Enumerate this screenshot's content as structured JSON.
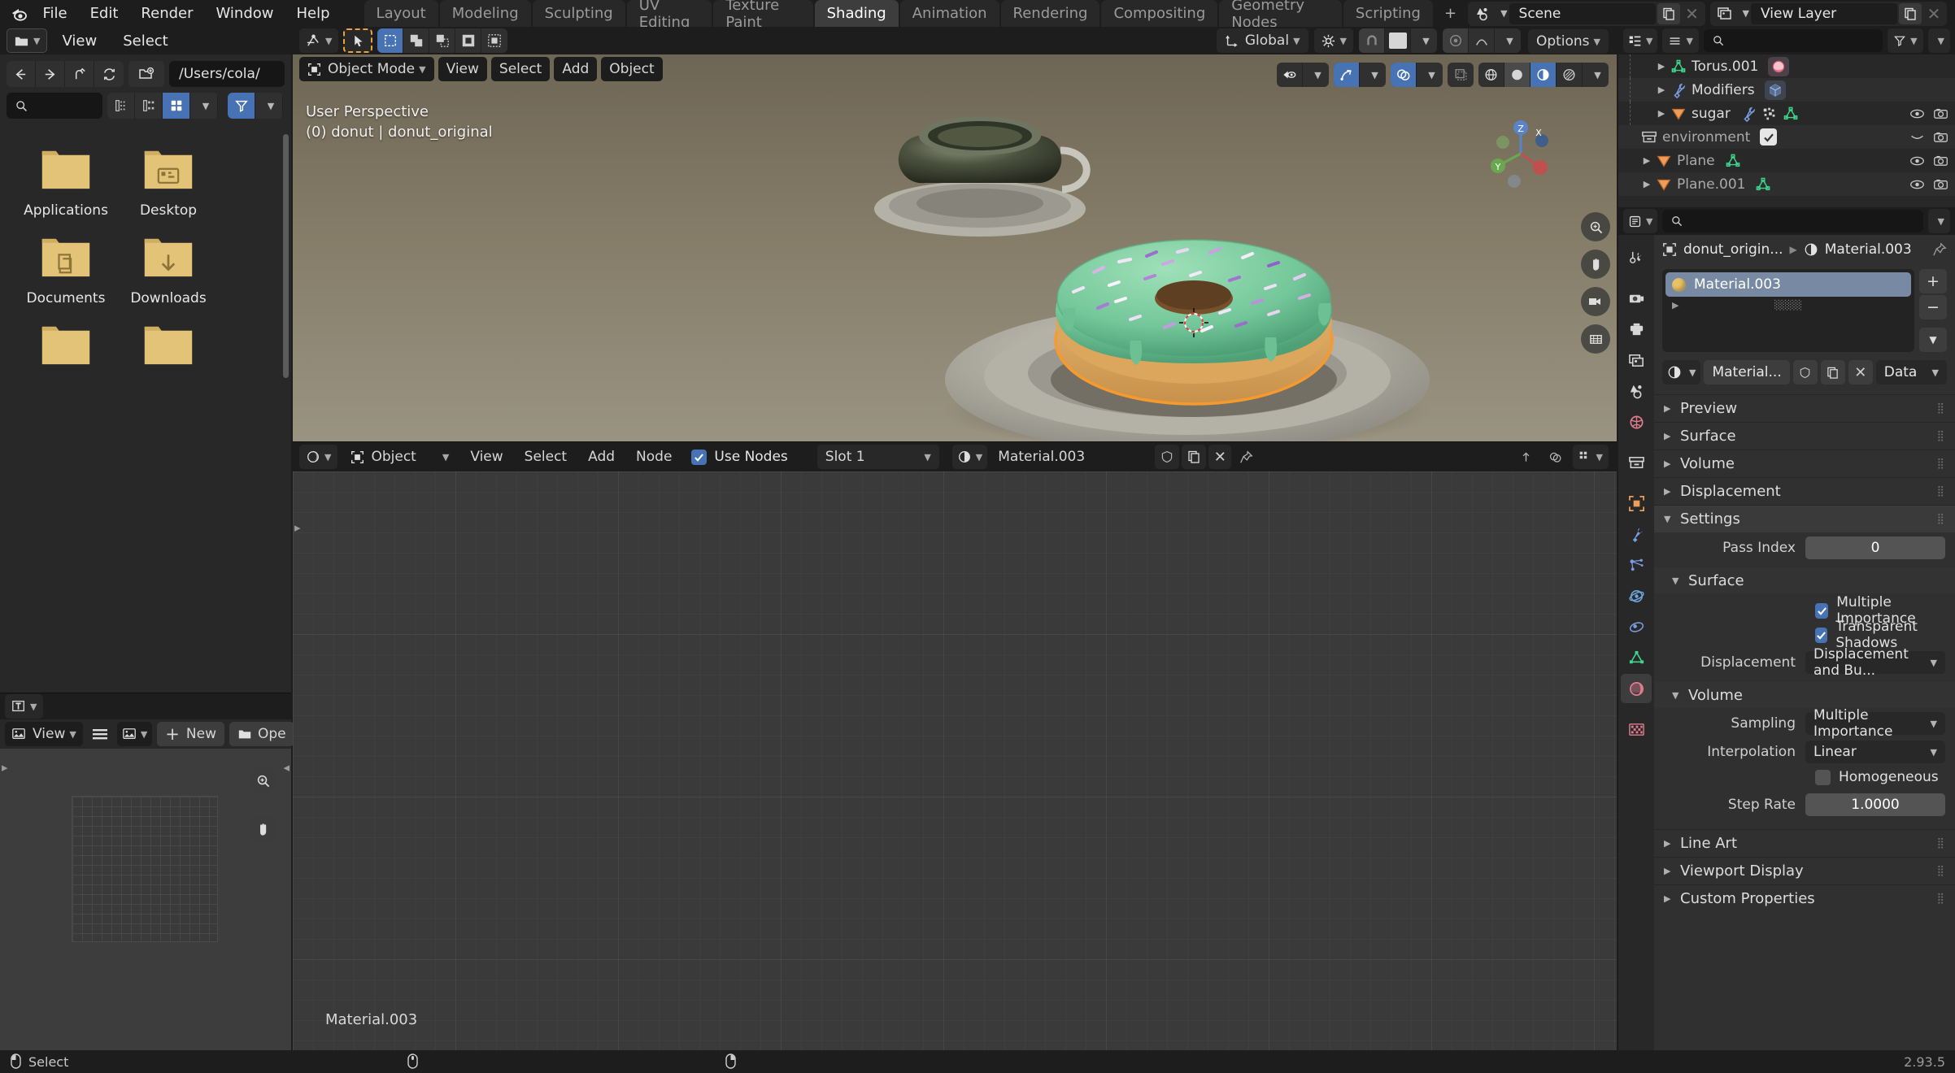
{
  "app": {
    "version": "2.93.5"
  },
  "topbar": {
    "menus": [
      "File",
      "Edit",
      "Render",
      "Window",
      "Help"
    ],
    "workspaces": [
      {
        "label": "Layout",
        "active": false
      },
      {
        "label": "Modeling",
        "active": false
      },
      {
        "label": "Sculpting",
        "active": false
      },
      {
        "label": "UV Editing",
        "active": false
      },
      {
        "label": "Texture Paint",
        "active": false
      },
      {
        "label": "Shading",
        "active": true
      },
      {
        "label": "Animation",
        "active": false
      },
      {
        "label": "Rendering",
        "active": false
      },
      {
        "label": "Compositing",
        "active": false
      },
      {
        "label": "Geometry Nodes",
        "active": false
      },
      {
        "label": "Scripting",
        "active": false
      }
    ],
    "add_workspace": "+",
    "scene": {
      "label": "Scene"
    },
    "view_layer": {
      "label": "View Layer"
    }
  },
  "file_browser": {
    "menus": [
      "View",
      "Select"
    ],
    "path": "/Users/cola/",
    "search_placeholder": "",
    "items": [
      {
        "label": "Applications",
        "icon": "folder-plain-icon"
      },
      {
        "label": "Desktop",
        "icon": "folder-desktop-icon"
      },
      {
        "label": "Documents",
        "icon": "folder-documents-icon"
      },
      {
        "label": "Downloads",
        "icon": "folder-downloads-icon"
      },
      {
        "label": "",
        "icon": "folder-plain-icon"
      },
      {
        "label": "",
        "icon": "folder-plain-icon"
      }
    ]
  },
  "image_editor": {
    "view_menu": "View",
    "new_button": "New",
    "open_button": "Ope"
  },
  "viewport": {
    "mode": "Object Mode",
    "menus": [
      "View",
      "Select",
      "Add",
      "Object"
    ],
    "transform_orientation": "Global",
    "options_label": "Options",
    "overlay_line1": "User Perspective",
    "overlay_line2": "(0) donut | donut_original",
    "gizmo_axes": [
      "X",
      "Y",
      "Z"
    ]
  },
  "shader_editor": {
    "mode": "Object",
    "menus": [
      "View",
      "Select",
      "Add",
      "Node"
    ],
    "use_nodes_label": "Use Nodes",
    "use_nodes_checked": true,
    "slot": "Slot 1",
    "material_name": "Material.003",
    "canvas_label": "Material.003"
  },
  "outliner": {
    "search_placeholder": "",
    "rows": [
      {
        "label": "Torus.001",
        "icon": "mesh-data-icon",
        "indent": 2,
        "expand": "collapsed",
        "badge": "material-icon",
        "eye": false,
        "camera": false
      },
      {
        "label": "Modifiers",
        "icon": "wrench-icon",
        "indent": 2,
        "expand": "collapsed",
        "badge": "modifier-cube-icon",
        "eye": false,
        "camera": false
      },
      {
        "label": "sugar",
        "icon": "object-mesh-icon",
        "indent": 2,
        "expand": "collapsed",
        "badge": "wrench-particles-mesh",
        "eye": true,
        "camera": true
      },
      {
        "label": "environment",
        "icon": "collection-icon",
        "indent": 0,
        "expand": "none",
        "badge": "checkbox-on",
        "eye": false,
        "camera": true
      },
      {
        "label": "Plane",
        "icon": "object-mesh-icon",
        "indent": 1,
        "expand": "collapsed",
        "badge": "mesh-data-icon",
        "eye": true,
        "camera": true
      },
      {
        "label": "Plane.001",
        "icon": "object-mesh-icon",
        "indent": 1,
        "expand": "collapsed",
        "badge": "mesh-data-icon",
        "eye": true,
        "camera": true
      }
    ]
  },
  "properties": {
    "search_placeholder": "",
    "breadcrumb": [
      "donut_origin...",
      "Material.003"
    ],
    "material_slots": [
      {
        "name": "Material.003",
        "selected": true
      }
    ],
    "material_id": {
      "name": "Material...",
      "data_label": "Data"
    },
    "panels": [
      {
        "label": "Preview",
        "open": false
      },
      {
        "label": "Surface",
        "open": false
      },
      {
        "label": "Volume",
        "open": false
      },
      {
        "label": "Displacement",
        "open": false
      },
      {
        "label": "Settings",
        "open": true
      }
    ],
    "settings": {
      "pass_index_label": "Pass Index",
      "pass_index_value": "0",
      "surface_subpanel": "Surface",
      "multiple_importance_label": "Multiple Importance",
      "multiple_importance_checked": true,
      "transparent_shadows_label": "Transparent Shadows",
      "transparent_shadows_checked": true,
      "displacement_label": "Displacement",
      "displacement_value": "Displacement and Bu...",
      "volume_subpanel": "Volume",
      "sampling_label": "Sampling",
      "sampling_value": "Multiple Importance",
      "interpolation_label": "Interpolation",
      "interpolation_value": "Linear",
      "homogeneous_label": "Homogeneous",
      "homogeneous_checked": false,
      "step_rate_label": "Step Rate",
      "step_rate_value": "1.0000"
    },
    "bottom_panels": [
      {
        "label": "Line Art",
        "open": false
      },
      {
        "label": "Viewport Display",
        "open": false
      },
      {
        "label": "Custom Properties",
        "open": false
      }
    ],
    "tabs": [
      {
        "name": "tool-icon",
        "active": false
      },
      {
        "name": "render-icon",
        "active": false
      },
      {
        "name": "output-icon",
        "active": false
      },
      {
        "name": "view-layer-icon",
        "active": false
      },
      {
        "name": "scene-icon",
        "active": false
      },
      {
        "name": "world-icon",
        "active": false
      },
      {
        "name": "collection-icon",
        "active": false
      },
      {
        "name": "object-icon",
        "active": false
      },
      {
        "name": "modifier-icon",
        "active": false
      },
      {
        "name": "particles-icon",
        "active": false
      },
      {
        "name": "physics-icon",
        "active": false
      },
      {
        "name": "constraints-icon",
        "active": false
      },
      {
        "name": "object-data-icon",
        "active": false
      },
      {
        "name": "material-icon",
        "active": true
      },
      {
        "name": "texture-icon",
        "active": false
      }
    ]
  },
  "statusbar": {
    "select_label": "Select",
    "version": "2.93.5"
  },
  "colors": {
    "accent_blue": "#4772b3",
    "header_dark": "#1d1d1d",
    "editor_bg": "#303030",
    "panel_bg": "#282828",
    "folder_yellow": "#e3c377",
    "mesh_green": "#3dd68c",
    "object_orange": "#ed9e5c",
    "material_red": "#e07b8d",
    "modifier_blue": "#7a9de0"
  }
}
